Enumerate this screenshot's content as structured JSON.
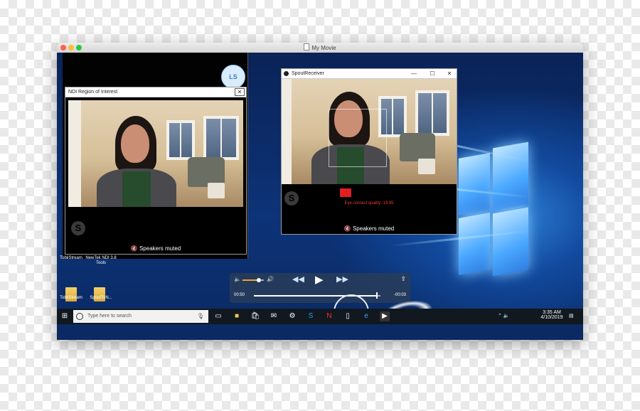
{
  "app": {
    "title": "My Movie"
  },
  "skype_main": {
    "avatar_initials": "LS"
  },
  "ndi_window": {
    "title": "NDI Region of Interest",
    "close_label": "✕",
    "speaker_status": "Speakers muted",
    "skype_badge": "S"
  },
  "spout_window": {
    "title": "SpoutReceiver",
    "min_label": "—",
    "max_label": "☐",
    "close_label": "✕",
    "quality_text": "Eye-contact quality: 19.85",
    "speaker_status": "Speakers muted",
    "skype_badge": "S"
  },
  "desktop_icons": [
    {
      "label": "TobiiStream"
    },
    {
      "label": "NewTek NDI 3.8 Tools"
    },
    {
      "label": "TobiiStream"
    },
    {
      "label": "SpoutToN..."
    }
  ],
  "media_controls": {
    "elapsed": "00:50",
    "remaining": "-00:03",
    "progress": 0.97,
    "volume": 0.75
  },
  "taskbar": {
    "search_placeholder": "Type here to search",
    "time": "3:35 AM",
    "date": "4/10/2019"
  },
  "colors": {
    "accent_orange": "#f0a030",
    "record_red": "#e02020",
    "desktop_blue": "#0b2a63"
  },
  "icons": [
    "windows-start-icon",
    "search-icon",
    "mic-icon",
    "task-view-icon",
    "file-explorer-icon",
    "store-icon",
    "mail-icon",
    "app-icon",
    "skype-icon",
    "newtek-icon",
    "tablet-icon",
    "edge-icon",
    "player-icon"
  ]
}
